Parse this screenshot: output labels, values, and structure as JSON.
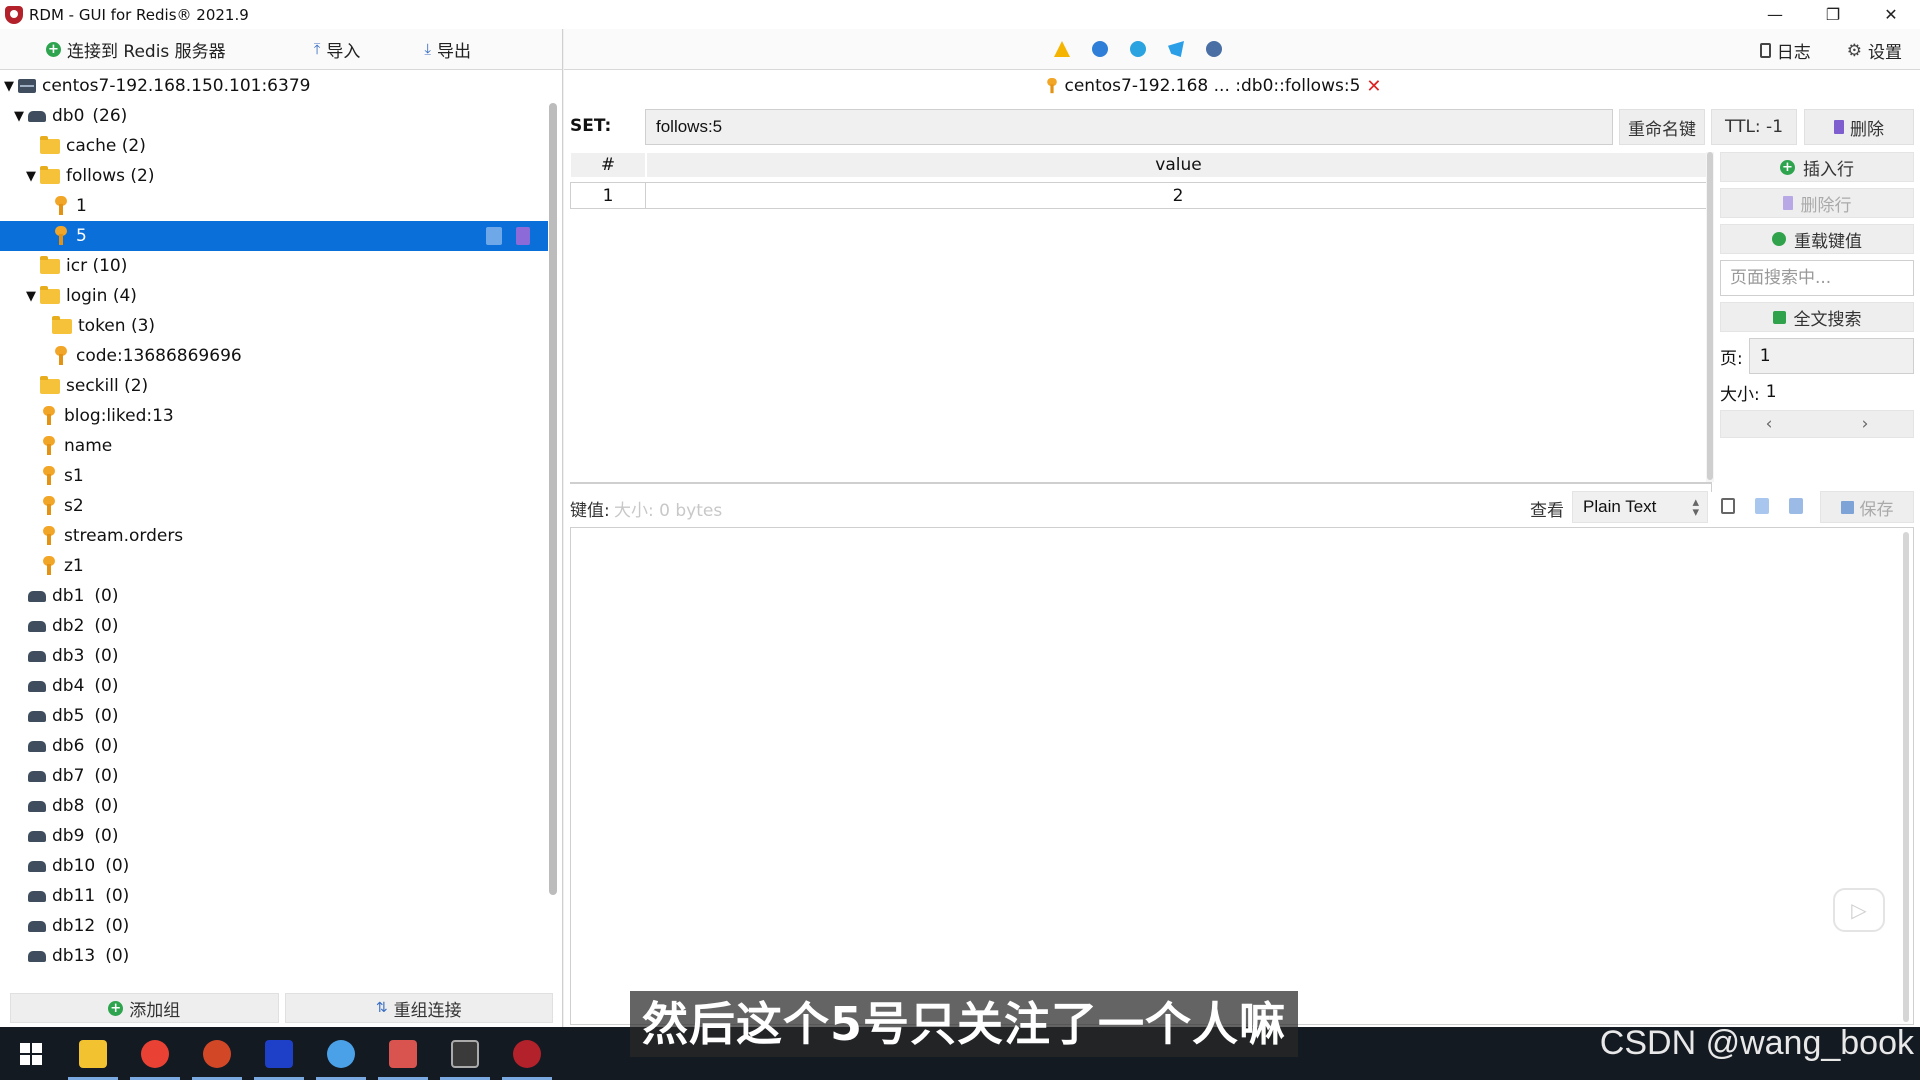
{
  "window": {
    "title": "RDM - GUI for Redis® 2021.9",
    "controls": [
      "—",
      "❐",
      "✕"
    ]
  },
  "left_toolbar": {
    "connect": "连接到 Redis 服务器",
    "import": "导入",
    "export": "导出"
  },
  "tree": {
    "server": "centos7-192.168.150.101:6379",
    "db0": {
      "name": "db0",
      "count": "(26)"
    },
    "items": [
      {
        "label": "cache (2)",
        "type": "folder"
      },
      {
        "label": "follows (2)",
        "type": "folder"
      },
      {
        "label": "1",
        "type": "key"
      },
      {
        "label": "5",
        "type": "key"
      },
      {
        "label": "icr (10)",
        "type": "folder"
      },
      {
        "label": "login (4)",
        "type": "folder"
      },
      {
        "label": "token (3)",
        "type": "folder"
      },
      {
        "label": "code:13686869696",
        "type": "key"
      },
      {
        "label": "seckill (2)",
        "type": "folder"
      },
      {
        "label": "blog:liked:13",
        "type": "key"
      },
      {
        "label": "name",
        "type": "key"
      },
      {
        "label": "s1",
        "type": "key"
      },
      {
        "label": "s2",
        "type": "key"
      },
      {
        "label": "stream.orders",
        "type": "key"
      },
      {
        "label": "z1",
        "type": "key"
      }
    ],
    "databases": [
      {
        "name": "db1",
        "count": "(0)"
      },
      {
        "name": "db2",
        "count": "(0)"
      },
      {
        "name": "db3",
        "count": "(0)"
      },
      {
        "name": "db4",
        "count": "(0)"
      },
      {
        "name": "db5",
        "count": "(0)"
      },
      {
        "name": "db6",
        "count": "(0)"
      },
      {
        "name": "db7",
        "count": "(0)"
      },
      {
        "name": "db8",
        "count": "(0)"
      },
      {
        "name": "db9",
        "count": "(0)"
      },
      {
        "name": "db10",
        "count": "(0)"
      },
      {
        "name": "db11",
        "count": "(0)"
      },
      {
        "name": "db12",
        "count": "(0)"
      },
      {
        "name": "db13",
        "count": "(0)"
      }
    ]
  },
  "left_bottom": {
    "add_group": "添加组",
    "regroup": "重组连接"
  },
  "right_toolbar": {
    "log": "日志",
    "settings": "设置"
  },
  "tab": {
    "title": "centos7-192.168 ... :db0::follows:5",
    "close": "✕"
  },
  "key": {
    "type": "SET:",
    "name": "follows:5",
    "rename": "重命名键",
    "ttl": "TTL:  -1",
    "delete": "删除"
  },
  "table": {
    "headers": [
      "#",
      "value"
    ],
    "rows": [
      [
        "1",
        "2"
      ]
    ]
  },
  "side": {
    "insert_row": "插入行",
    "delete_row": "删除行",
    "reload": "重载键值",
    "search_placeholder": "页面搜索中...",
    "fulltext": "全文搜索",
    "page_label": "页:",
    "page_value": "1",
    "size_label": "大小:",
    "size_value": "1",
    "prev": "‹",
    "next": "›"
  },
  "value_bar": {
    "label": "键值:",
    "size": "大小:  0 bytes",
    "view_label": "查看",
    "view_mode": "Plain Text",
    "save": "保存"
  },
  "subtitle": "然后这个5号只关注了一个人嘛",
  "watermark": "CSDN @wang_book"
}
